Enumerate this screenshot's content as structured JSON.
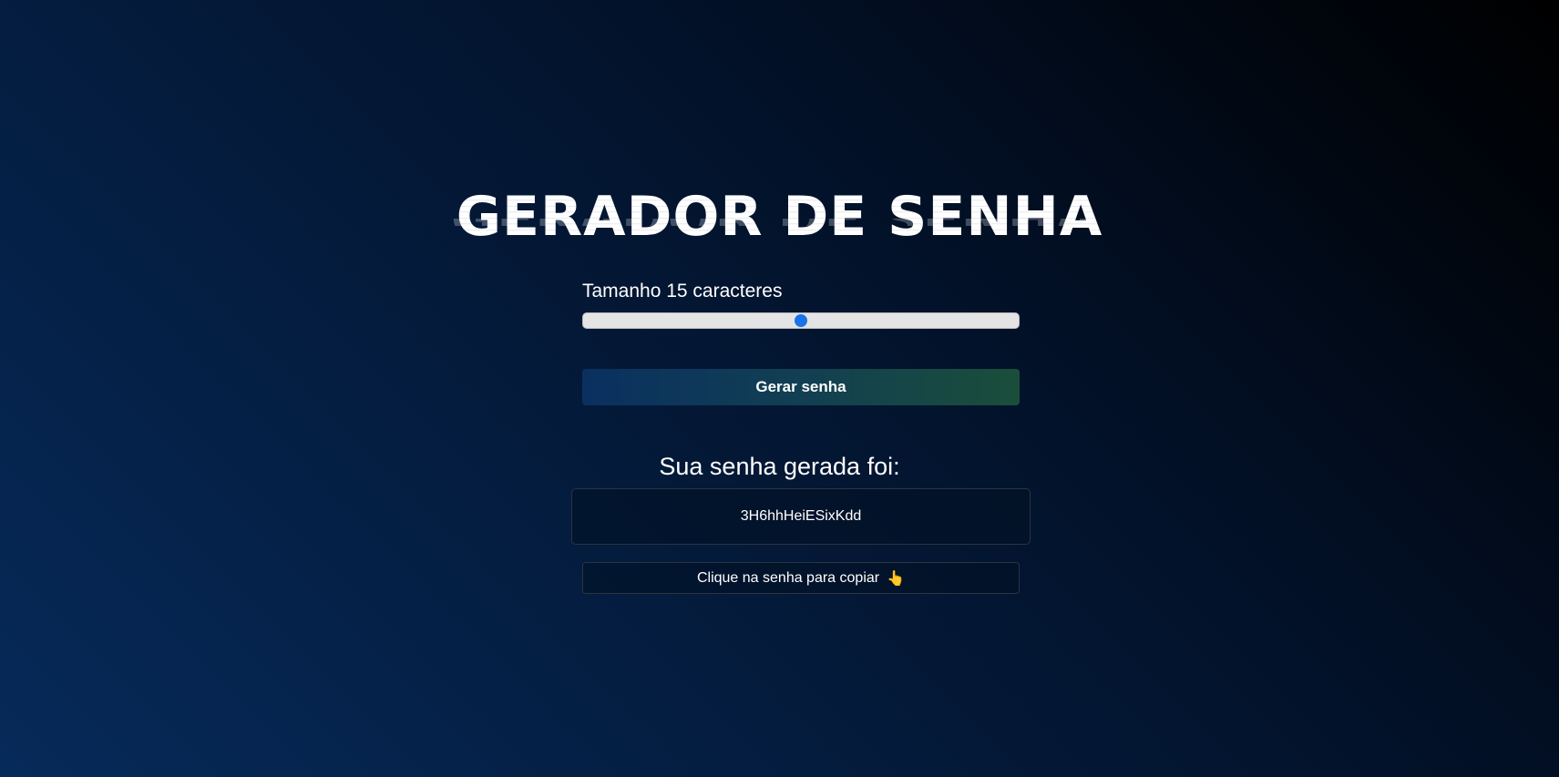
{
  "app": {
    "title": "GERADOR DE SENHA"
  },
  "length": {
    "label": "Tamanho 15 caracteres",
    "value": 15,
    "slider_fraction": 0.5
  },
  "generate_button": {
    "label": "Gerar senha"
  },
  "result": {
    "title": "Sua senha gerada foi:",
    "password": "3H6hhHeiESixKdd",
    "copy_hint": "Clique na senha para copiar",
    "copy_hint_icon": "pointing-hand-icon"
  },
  "colors": {
    "slider_thumb": "#1a73e8",
    "slider_track": "#e4e4e4",
    "button_gradient_start": "#0a3060",
    "button_gradient_end": "#1a4e3a"
  }
}
